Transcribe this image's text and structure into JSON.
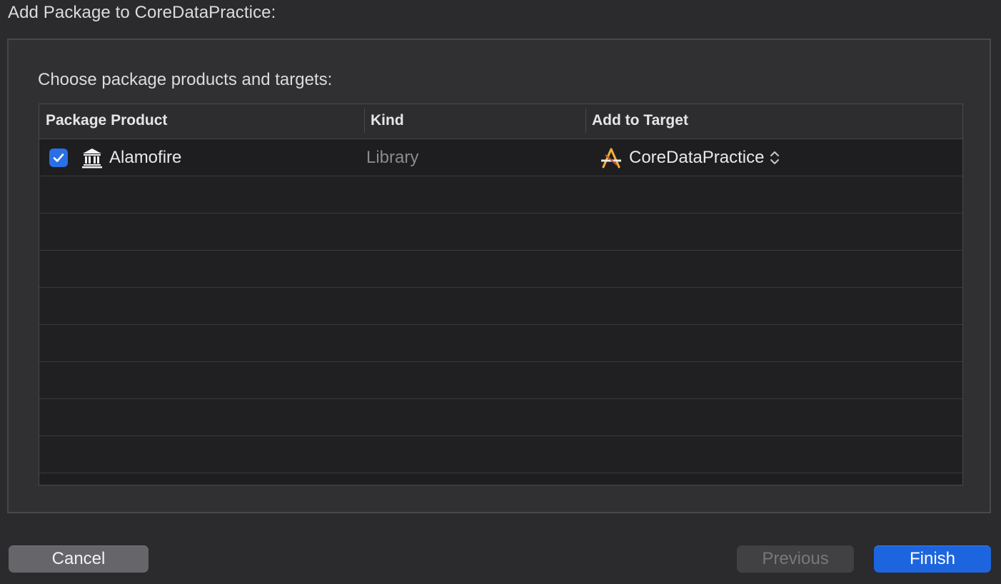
{
  "dialog": {
    "title": "Add Package to CoreDataPractice:",
    "instruction": "Choose package products and targets:"
  },
  "table": {
    "columns": [
      "Package Product",
      "Kind",
      "Add to Target"
    ],
    "rows": [
      {
        "checked": true,
        "product": "Alamofire",
        "product_icon": "library-icon",
        "kind": "Library",
        "target": "CoreDataPractice",
        "target_icon": "app-target-icon"
      }
    ],
    "empty_rows": 8
  },
  "buttons": {
    "cancel": "Cancel",
    "previous": "Previous",
    "finish": "Finish"
  },
  "colors": {
    "accent": "#1d65df",
    "checkbox": "#2a6fe6",
    "background": "#2b2b2d"
  }
}
